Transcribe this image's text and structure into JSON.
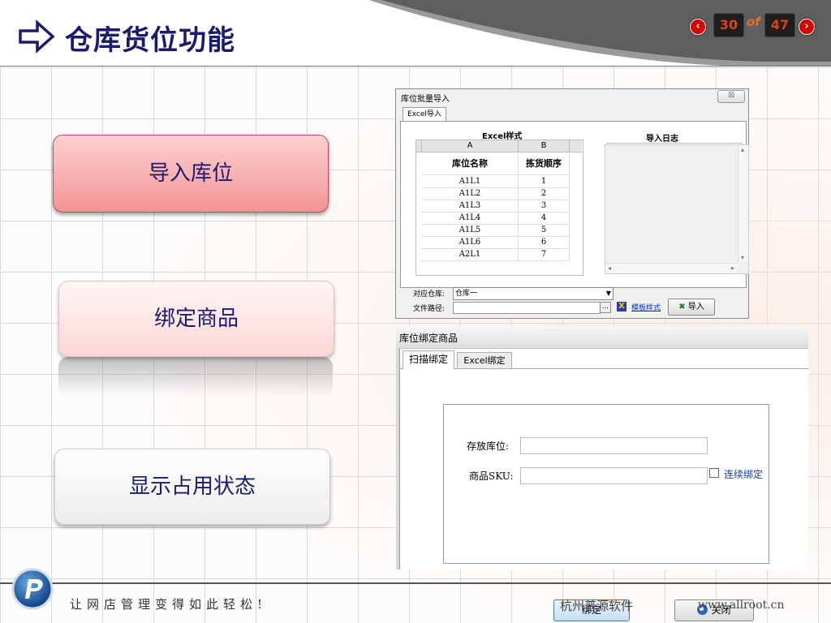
{
  "slide": {
    "title": "仓库货位功能",
    "page_current": "30",
    "page_of": "of",
    "page_total": "47"
  },
  "left_buttons": {
    "import": "导入库位",
    "bind": "绑定商品",
    "status": "显示占用状态"
  },
  "import_window": {
    "title": "库位批量导入",
    "close": "☒",
    "tab": "Excel导入",
    "excel_caption": "Excel样式",
    "col_a": "A",
    "col_b": "B",
    "header_name": "库位名称",
    "header_order": "拣货顺序",
    "rows": [
      {
        "name": "A1L1",
        "order": "1"
      },
      {
        "name": "A1L2",
        "order": "2"
      },
      {
        "name": "A1L3",
        "order": "3"
      },
      {
        "name": "A1L4",
        "order": "4"
      },
      {
        "name": "A1L5",
        "order": "5"
      },
      {
        "name": "A1L6",
        "order": "6"
      },
      {
        "name": "A2L1",
        "order": "7"
      }
    ],
    "log_caption": "导入日志",
    "warehouse_label": "对应仓库:",
    "warehouse_value": "仓库一",
    "path_label": "文件路径:",
    "browse": "...",
    "template_link": "模板样式",
    "import_button": "导入"
  },
  "bind_window": {
    "title": "库位绑定商品",
    "tab_scan": "扫描绑定",
    "tab_excel": "Excel绑定",
    "location_label": "存放库位:",
    "sku_label": "商品SKU:",
    "continuous_label": "连续绑定",
    "bind_button": "绑定",
    "close_button": "关闭"
  },
  "footer": {
    "slogan": "让网店管理变得如此轻松!",
    "company": "杭州普源软件",
    "website": "www.allroot.cn"
  },
  "colors": {
    "title": "#1a1a6e",
    "pager_number": "#d8431a",
    "link": "#0033cc"
  }
}
